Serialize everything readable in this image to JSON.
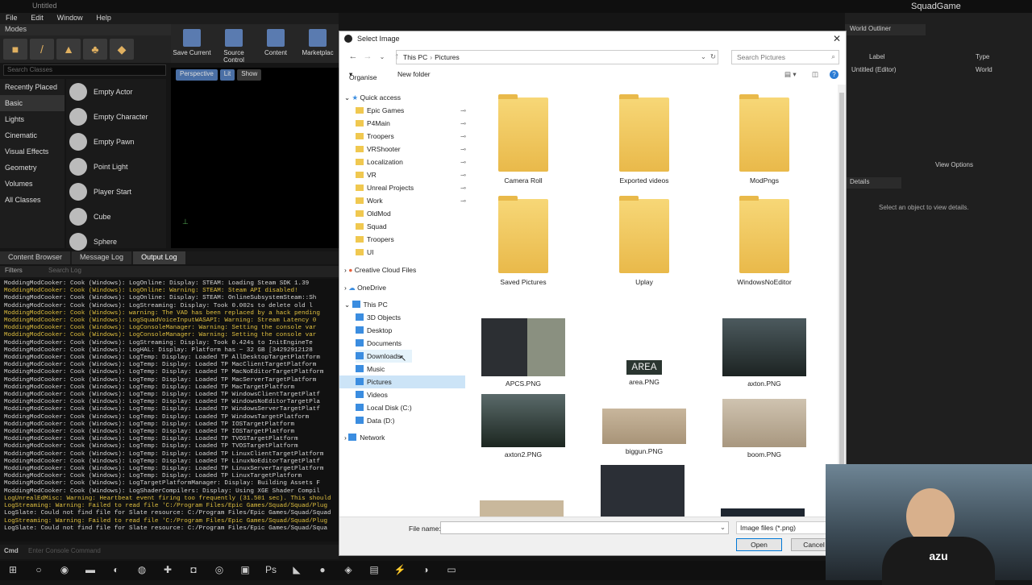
{
  "ue": {
    "window_title": "Untitled",
    "menu": [
      "File",
      "Edit",
      "Window",
      "Help"
    ],
    "project_name": "SquadGame",
    "modes_tab": "Modes",
    "toolbar": {
      "save_current": "Save Current",
      "source_control": "Source Control",
      "content": "Content",
      "marketplace": "Marketplac"
    },
    "search_classes_placeholder": "Search Classes",
    "categories": [
      "Recently Placed",
      "Basic",
      "Lights",
      "Cinematic",
      "Visual Effects",
      "Geometry",
      "Volumes",
      "All Classes"
    ],
    "place_items": [
      "Empty Actor",
      "Empty Character",
      "Empty Pawn",
      "Point Light",
      "Player Start",
      "Cube",
      "Sphere"
    ],
    "viewport_buttons": [
      "Perspective",
      "Lit",
      "Show"
    ],
    "bottom_tabs": [
      "Content Browser",
      "Message Log",
      "Output Log"
    ],
    "filters": "Filters",
    "search_log_placeholder": "Search Log",
    "cmd_label": "Cmd",
    "cmd_placeholder": "Enter Console Command",
    "world_outliner_tab": "World Outliner",
    "outliner_columns": {
      "label": "Label",
      "type": "Type"
    },
    "outliner_item": {
      "label": "Untitled (Editor)",
      "type": "World"
    },
    "details_tab": "Details",
    "view_options": "View Options",
    "details_empty": "Select an object to view details.",
    "log_lines": [
      {
        "t": "ModdingModCooker: Cook (Windows):    LogOnline: Display: STEAM: Loading Steam SDK 1.39",
        "w": false
      },
      {
        "t": "ModdingModCooker: Cook (Windows):    LogOnline: Warning: STEAM: Steam API disabled!",
        "w": true
      },
      {
        "t": "ModdingModCooker: Cook (Windows):    LogOnline: Display: STEAM: OnlineSubsystemSteam::Sh",
        "w": false
      },
      {
        "t": "ModdingModCooker: Cook (Windows):    LogStreaming: Display: Took  0.002s to delete old l",
        "w": false
      },
      {
        "t": "ModdingModCooker: Cook (Windows):    warning: The VAD has been replaced by a hack pending",
        "w": true
      },
      {
        "t": "ModdingModCooker: Cook (Windows):    LogSquadVoiceInputWASAPI: Warning: Stream Latency 0",
        "w": true
      },
      {
        "t": "ModdingModCooker: Cook (Windows):    LogConsoleManager: Warning: Setting the console var",
        "w": true
      },
      {
        "t": "ModdingModCooker: Cook (Windows):    LogConsoleManager: Warning: Setting the console var",
        "w": true
      },
      {
        "t": "ModdingModCooker: Cook (Windows):    LogStreaming: Display: Took  0.424s to InitEngineTe",
        "w": false
      },
      {
        "t": "ModdingModCooker: Cook (Windows):    LogHAL: Display: Platform has ~ 32 GB [34292912128",
        "w": false
      },
      {
        "t": "ModdingModCooker: Cook (Windows):    LogTemp: Display: Loaded TP AllDesktopTargetPlatform",
        "w": false
      },
      {
        "t": "ModdingModCooker: Cook (Windows):    LogTemp: Display: Loaded TP MacClientTargetPlatform",
        "w": false
      },
      {
        "t": "ModdingModCooker: Cook (Windows):    LogTemp: Display: Loaded TP MacNoEditorTargetPlatform",
        "w": false
      },
      {
        "t": "ModdingModCooker: Cook (Windows):    LogTemp: Display: Loaded TP MacServerTargetPlatform",
        "w": false
      },
      {
        "t": "ModdingModCooker: Cook (Windows):    LogTemp: Display: Loaded TP MacTargetPlatform",
        "w": false
      },
      {
        "t": "ModdingModCooker: Cook (Windows):    LogTemp: Display: Loaded TP WindowsClientTargetPlatf",
        "w": false
      },
      {
        "t": "ModdingModCooker: Cook (Windows):    LogTemp: Display: Loaded TP WindowsNoEditorTargetPla",
        "w": false
      },
      {
        "t": "ModdingModCooker: Cook (Windows):    LogTemp: Display: Loaded TP WindowsServerTargetPlatf",
        "w": false
      },
      {
        "t": "ModdingModCooker: Cook (Windows):    LogTemp: Display: Loaded TP WindowsTargetPlatform",
        "w": false
      },
      {
        "t": "ModdingModCooker: Cook (Windows):    LogTemp: Display: Loaded TP IOSTargetPlatform",
        "w": false
      },
      {
        "t": "ModdingModCooker: Cook (Windows):    LogTemp: Display: Loaded TP IOSTargetPlatform",
        "w": false
      },
      {
        "t": "ModdingModCooker: Cook (Windows):    LogTemp: Display: Loaded TP TVOSTargetPlatform",
        "w": false
      },
      {
        "t": "ModdingModCooker: Cook (Windows):    LogTemp: Display: Loaded TP TVOSTargetPlatform",
        "w": false
      },
      {
        "t": "ModdingModCooker: Cook (Windows):    LogTemp: Display: Loaded TP LinuxClientTargetPlatform",
        "w": false
      },
      {
        "t": "ModdingModCooker: Cook (Windows):    LogTemp: Display: Loaded TP LinuxNoEditorTargetPlatf",
        "w": false
      },
      {
        "t": "ModdingModCooker: Cook (Windows):    LogTemp: Display: Loaded TP LinuxServerTargetPlatform",
        "w": false
      },
      {
        "t": "ModdingModCooker: Cook (Windows):    LogTemp: Display: Loaded TP LinuxTargetPlatform",
        "w": false
      },
      {
        "t": "ModdingModCooker: Cook (Windows):    LogTargetPlatformManager: Display: Building Assets F",
        "w": false
      },
      {
        "t": "ModdingModCooker: Cook (Windows):    LogShaderCompilers: Display: Using XGE Shader Compil",
        "w": false
      },
      {
        "t": "LogUnrealEdMisc: Warning: Heartbeat event firing too frequently (31.501 sec). This should",
        "w": true
      },
      {
        "t": "LogStreaming: Warning: Failed to read file 'C:/Program Files/Epic Games/Squad/Squad/Plug",
        "w": true
      },
      {
        "t": "LogSlate: Could not find file for Slate resource: C:/Program Files/Epic Games/Squad/Squad",
        "w": false
      },
      {
        "t": "LogStreaming: Warning: Failed to read file 'C:/Program Files/Epic Games/Squad/Squad/Plug",
        "w": true
      },
      {
        "t": "LogSlate: Could not find file for Slate resource: C:/Program Files/Epic Games/Squad/Squa",
        "w": false
      }
    ]
  },
  "dialog": {
    "title": "Select Image",
    "address": [
      "This PC",
      "Pictures"
    ],
    "search_placeholder": "Search Pictures",
    "organise": "Organise",
    "new_folder": "New folder",
    "quick_access": "Quick access",
    "quick_items": [
      "Epic Games",
      "P4Main",
      "Troopers",
      "VRShooter",
      "Localization",
      "VR",
      "Unreal Projects",
      "Work",
      "OldMod",
      "Squad",
      "Troopers",
      "UI"
    ],
    "creative_cloud": "Creative Cloud Files",
    "onedrive": "OneDrive",
    "this_pc": "This PC",
    "pc_items": [
      "3D Objects",
      "Desktop",
      "Documents",
      "Downloads",
      "Music",
      "Pictures",
      "Videos",
      "Local Disk (C:)",
      "Data (D:)"
    ],
    "network": "Network",
    "folders": [
      "Camera Roll",
      "Exported videos",
      "ModPngs",
      "Saved Pictures",
      "Uplay",
      "WindowsNoEditor"
    ],
    "images": [
      "APCS.PNG",
      "area.PNG",
      "axton.PNG",
      "axton2.PNG",
      "biggun.PNG",
      "boom.PNG"
    ],
    "area_thumb_text": "AREA",
    "file_name_label": "File name:",
    "file_name_value": "",
    "file_type": "Image files (*.png)",
    "open": "Open",
    "cancel": "Cancel"
  },
  "webcam_shirt_text": "azu"
}
